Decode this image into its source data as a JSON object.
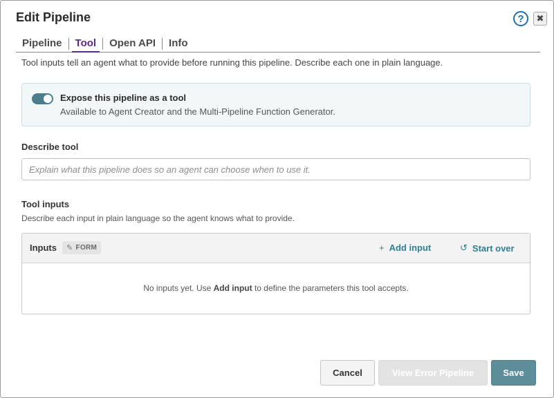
{
  "dialog": {
    "title": "Edit Pipeline",
    "help_glyph": "?",
    "close_glyph": "✖"
  },
  "tabs": [
    {
      "label": "Pipeline",
      "active": false
    },
    {
      "label": "Tool",
      "active": true
    },
    {
      "label": "Open API",
      "active": false
    },
    {
      "label": "Info",
      "active": false
    }
  ],
  "intro_text": "Tool inputs tell an agent what to provide before running this pipeline. Describe each one in plain language.",
  "expose": {
    "enabled": true,
    "title": "Expose this pipeline as a tool",
    "subtitle": "Available to Agent Creator and the Multi-Pipeline Function Generator."
  },
  "describe_tool": {
    "label": "Describe tool",
    "value": "",
    "placeholder": "Explain what this pipeline does so an agent can choose when to use it."
  },
  "tool_inputs": {
    "label": "Tool inputs",
    "description": "Describe each input in plain language so the agent knows what to provide.",
    "panel": {
      "title": "Inputs",
      "badge": "FORM",
      "add_input_label": "Add input",
      "start_over_label": "Start over",
      "empty_prefix": "No inputs yet. Use ",
      "empty_bold": "Add input",
      "empty_suffix": " to define the parameters this tool accepts."
    }
  },
  "footer": {
    "cancel_label": "Cancel",
    "view_error_label": "View Error Pipeline",
    "save_label": "Save"
  },
  "colors": {
    "accent_tab": "#5b2a86",
    "link": "#2f7f91",
    "toggle_on": "#4b7d8c",
    "save_button": "#5e8d9a",
    "help_icon": "#1f6fae"
  }
}
